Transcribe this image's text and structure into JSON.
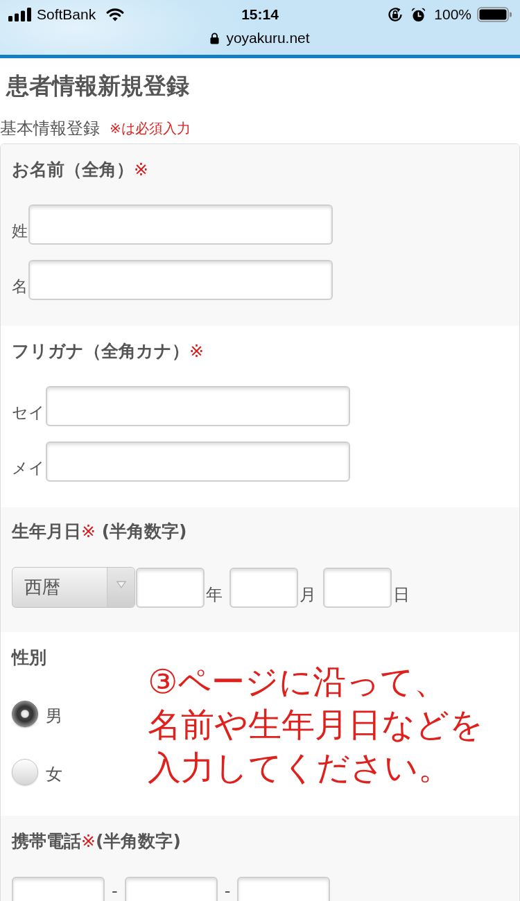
{
  "status_bar": {
    "carrier": "SoftBank",
    "time": "15:14",
    "battery": "100%"
  },
  "browser": {
    "url": "yoyakuru.net"
  },
  "page": {
    "title": "患者情報新規登録",
    "subtitle": "基本情報登録",
    "required_note": "※は必須入力"
  },
  "sections": [
    {
      "kind": "text_fields",
      "heading": "お名前（全角）",
      "required_mark": "※",
      "fields": [
        {
          "label": "姓"
        },
        {
          "label": "名"
        }
      ]
    },
    {
      "kind": "text_fields",
      "heading": "フリガナ（全角カナ）",
      "required_mark": "※",
      "fields": [
        {
          "label": "セイ"
        },
        {
          "label": "メイ"
        }
      ]
    },
    {
      "kind": "date",
      "heading": "生年月日",
      "required_mark": "※",
      "note": " (半角数字)",
      "controls": [
        {
          "kind": "select",
          "value": "西暦"
        },
        {
          "kind": "input"
        },
        {
          "kind": "text",
          "text": "年"
        },
        {
          "kind": "input"
        },
        {
          "kind": "text",
          "text": "月"
        },
        {
          "kind": "input"
        },
        {
          "kind": "text",
          "text": "日"
        }
      ]
    },
    {
      "kind": "radio",
      "heading": "性別",
      "options": [
        {
          "label": "男",
          "selected": true
        },
        {
          "label": "女",
          "selected": false
        }
      ]
    },
    {
      "kind": "phone",
      "heading": "携帯電話",
      "required_mark": "※",
      "note": "(半角数字)",
      "controls": [
        {
          "kind": "input"
        },
        {
          "kind": "text",
          "text": "-"
        },
        {
          "kind": "input"
        },
        {
          "kind": "text",
          "text": "-"
        },
        {
          "kind": "input"
        }
      ]
    }
  ],
  "annotation": {
    "lines": [
      "③ページに沿って、",
      "名前や生年月日などを",
      "入力してください。"
    ]
  }
}
